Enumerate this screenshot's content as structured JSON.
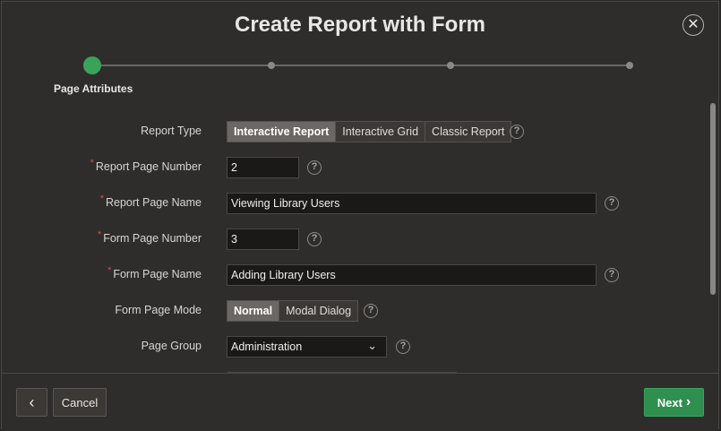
{
  "dialog": {
    "title": "Create Report with Form",
    "close_icon": "close-icon"
  },
  "wizard": {
    "steps_total": 4,
    "current_step": 1,
    "current_step_label": "Page Attributes"
  },
  "form": {
    "report_type": {
      "label": "Report Type",
      "options": [
        "Interactive Report",
        "Interactive Grid",
        "Classic Report"
      ],
      "selected": "Interactive Report"
    },
    "report_page_number": {
      "label": "Report Page Number",
      "value": "2",
      "required": true
    },
    "report_page_name": {
      "label": "Report Page Name",
      "value": "Viewing Library Users",
      "required": true
    },
    "form_page_number": {
      "label": "Form Page Number",
      "value": "3",
      "required": true
    },
    "form_page_name": {
      "label": "Form Page Name",
      "value": "Adding Library Users",
      "required": true
    },
    "form_page_mode": {
      "label": "Form Page Mode",
      "options": [
        "Normal",
        "Modal Dialog"
      ],
      "selected": "Normal"
    },
    "page_group": {
      "label": "Page Group",
      "value": "Administration"
    },
    "help_glyph": "?",
    "required_glyph": "*"
  },
  "footer": {
    "back_glyph": "‹",
    "cancel_label": "Cancel",
    "next_label": "Next",
    "next_glyph": "›"
  },
  "colors": {
    "accent": "#3aa35a",
    "background": "#2f2d2b",
    "required": "#e04848"
  }
}
